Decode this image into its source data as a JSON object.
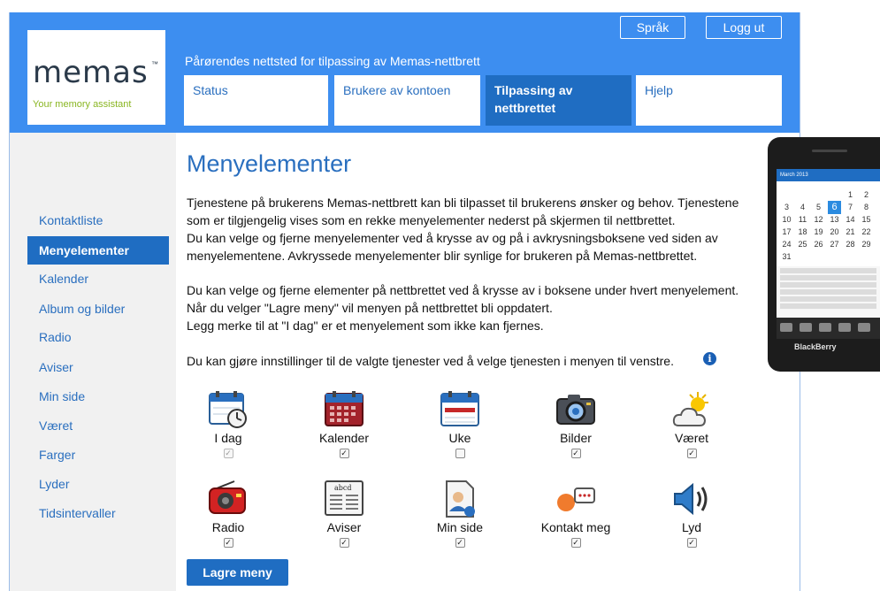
{
  "logo": {
    "word": "memas",
    "tm": "™",
    "tagline": "Your memory assistant"
  },
  "header": {
    "site_title": "Pårørendes nettsted for tilpassing av Memas-nettbrett",
    "language_button": "Språk",
    "logout_button": "Logg ut"
  },
  "tabs": [
    {
      "label": "Status",
      "active": false
    },
    {
      "label": "Brukere av kontoen",
      "active": false
    },
    {
      "label": "Tilpassing av nettbrettet",
      "active": true
    },
    {
      "label": "Hjelp",
      "active": false
    }
  ],
  "sidebar": {
    "items": [
      {
        "label": "Kontaktliste",
        "active": false
      },
      {
        "label": "Menyelementer",
        "active": true
      },
      {
        "label": "Kalender",
        "active": false
      },
      {
        "label": "Album og bilder",
        "active": false
      },
      {
        "label": "Radio",
        "active": false
      },
      {
        "label": "Aviser",
        "active": false
      },
      {
        "label": "Min side",
        "active": false
      },
      {
        "label": "Været",
        "active": false
      },
      {
        "label": "Farger",
        "active": false
      },
      {
        "label": "Lyder",
        "active": false
      },
      {
        "label": "Tidsintervaller",
        "active": false
      }
    ]
  },
  "main": {
    "title": "Menyelementer",
    "para1_line1": "Tjenestene på brukerens Memas-nettbrett kan bli tilpasset til brukerens ønsker og behov. Tjenestene",
    "para1_line2": "som er tilgjengelig vises som en rekke menyelementer nederst på skjermen til nettbrettet.",
    "para1_line3": "Du kan velge og fjerne menyelementer ved å krysse av og på i avkrysningsboksene ved siden av",
    "para1_line4": "menyelementene. Avkryssede menyelementer blir synlige for brukeren på Memas-nettbrettet.",
    "para2_line1": "Du kan velge og fjerne elementer på nettbrettet ved å krysse av i boksene under hvert menyelement.",
    "para2_line2": "Når du velger \"Lagre meny\" vil menyen på nettbrettet bli oppdatert.",
    "para2_line3": "Legg merke til at \"I dag\" er et menyelement som ikke kan fjernes.",
    "para3": "Du kan gjøre innstillinger til de valgte tjenester ved å velge tjenesten i menyen til venstre.",
    "info_glyph": "i",
    "save_button": "Lagre meny"
  },
  "menu_items": [
    {
      "label": "I dag",
      "icon": "today-calendar-clock-icon",
      "checked": true,
      "disabled": true
    },
    {
      "label": "Kalender",
      "icon": "calendar-icon",
      "checked": true,
      "disabled": false
    },
    {
      "label": "Uke",
      "icon": "week-calendar-icon",
      "checked": false,
      "disabled": false
    },
    {
      "label": "Bilder",
      "icon": "camera-icon",
      "checked": true,
      "disabled": false
    },
    {
      "label": "Været",
      "icon": "weather-sun-cloud-icon",
      "checked": true,
      "disabled": false
    },
    {
      "label": "Radio",
      "icon": "radio-icon",
      "checked": true,
      "disabled": false
    },
    {
      "label": "Aviser",
      "icon": "newspaper-icon",
      "checked": true,
      "disabled": false
    },
    {
      "label": "Min side",
      "icon": "my-page-document-icon",
      "checked": true,
      "disabled": false
    },
    {
      "label": "Kontakt meg",
      "icon": "contact-speech-icon",
      "checked": true,
      "disabled": false
    },
    {
      "label": "Lyd",
      "icon": "speaker-icon",
      "checked": true,
      "disabled": false
    }
  ],
  "phone": {
    "brand": "BlackBerry",
    "calendar_title": "March 2013",
    "calendar_rows": [
      [
        "",
        "",
        "",
        "",
        "1",
        "2"
      ],
      [
        "3",
        "4",
        "5",
        "6",
        "7",
        "8"
      ],
      [
        "10",
        "11",
        "12",
        "13",
        "14",
        "15"
      ],
      [
        "17",
        "18",
        "19",
        "20",
        "21",
        "22"
      ],
      [
        "24",
        "25",
        "26",
        "27",
        "28",
        "29"
      ],
      [
        "31",
        "",
        "",
        "",
        "",
        ""
      ]
    ],
    "today": "6"
  },
  "colors": {
    "header_blue": "#3d8ef0",
    "accent_blue": "#1f6dc2",
    "link_blue": "#2a6fbf",
    "logo_green": "#8ab622"
  }
}
